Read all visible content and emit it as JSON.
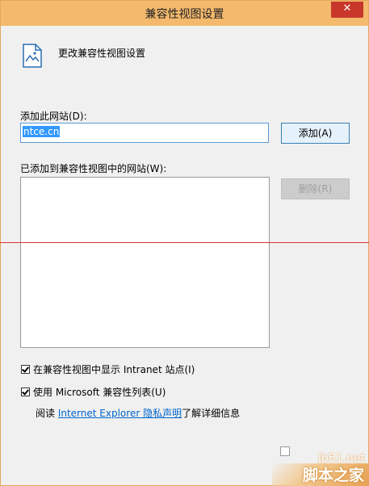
{
  "window": {
    "title": "兼容性视图设置",
    "close_label": "✕"
  },
  "header": {
    "text": "更改兼容性视图设置"
  },
  "add_site": {
    "label": "添加此网站(D):",
    "value": "ntce.cn",
    "button": "添加(A)"
  },
  "site_list": {
    "label": "已添加到兼容性视图中的网站(W):",
    "items": [],
    "remove_button": "删除(R)"
  },
  "options": {
    "intranet": {
      "label": "在兼容性视图中显示 Intranet 站点(I)",
      "checked": true
    },
    "ms_list": {
      "label": "使用 Microsoft 兼容性列表(U)",
      "checked": true
    }
  },
  "privacy": {
    "prefix": "阅读 ",
    "link": "Internet Explorer 隐私声明",
    "suffix": "了解详细信息"
  },
  "watermark": {
    "top": "jb51.net",
    "bottom": "脚本之家"
  },
  "colors": {
    "titlebar": "#f4b96c",
    "close": "#c7372a",
    "link": "#0066cc"
  }
}
